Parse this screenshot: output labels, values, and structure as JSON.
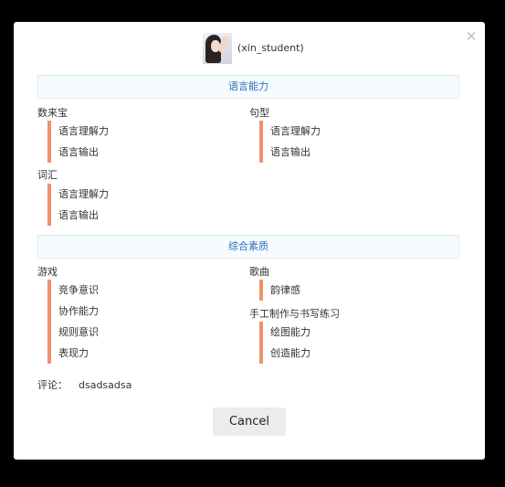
{
  "dialog": {
    "close_label": "×",
    "username": "(xin_student)",
    "sections": [
      {
        "title": "语言能力",
        "categories": [
          {
            "name": "数来宝",
            "items": [
              "语言理解力",
              "语言输出"
            ]
          },
          {
            "name": "句型",
            "items": [
              "语言理解力",
              "语言输出"
            ]
          },
          {
            "name": "词汇",
            "items": [
              "语言理解力",
              "语言输出"
            ]
          }
        ]
      },
      {
        "title": "综合素质",
        "categories": [
          {
            "name": "游戏",
            "items": [
              "竞争意识",
              "协作能力",
              "规则意识",
              "表现力"
            ]
          },
          {
            "name": "歌曲",
            "items": [
              "韵律感"
            ]
          },
          {
            "name": "手工制作与书写练习",
            "items": [
              "绘图能力",
              "创造能力"
            ]
          }
        ]
      }
    ],
    "comment_label": "评论：",
    "comment_value": "dsadsadsa",
    "cancel_label": "Cancel"
  },
  "colors": {
    "accent_bar": "#f0916a",
    "section_text": "#2f6fb3",
    "section_bg": "#f5fbff"
  }
}
